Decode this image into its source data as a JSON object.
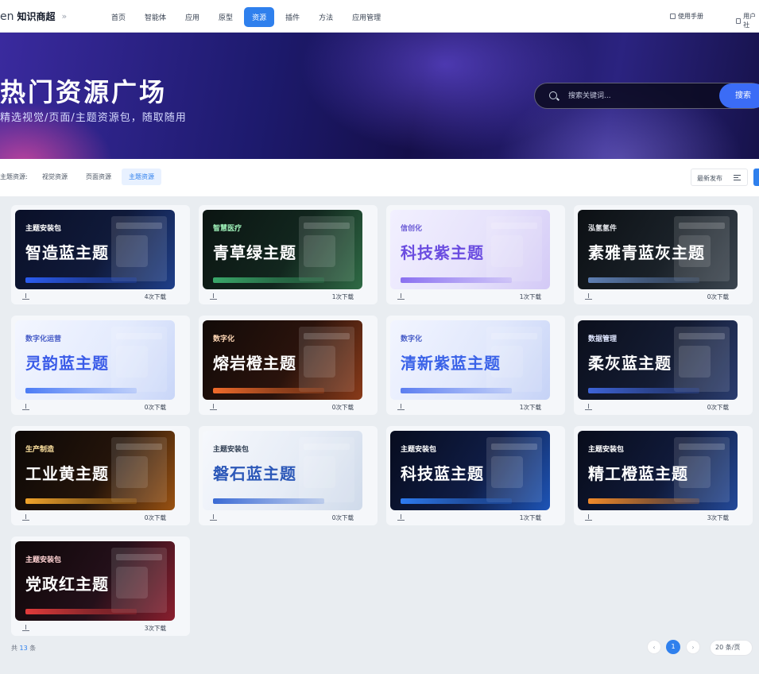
{
  "nav": {
    "logo_mark": "en",
    "brand": "知识商超",
    "chevron": "»",
    "items": [
      "首页",
      "智能体",
      "应用",
      "原型",
      "资源",
      "插件",
      "方法",
      "应用管理"
    ],
    "active": "资源",
    "manual": "使用手册",
    "user": "用户社"
  },
  "hero": {
    "title": "热门资源广场",
    "subtitle": "精选视觉/页面/主题资源包，随取随用",
    "search_placeholder": "搜索关键词...",
    "search_button": "搜索"
  },
  "filter": {
    "label": "主题资源:",
    "tags": [
      "视觉资源",
      "页面资源",
      "主题资源"
    ],
    "active": "主题资源",
    "sort": "最新发布"
  },
  "cards": [
    {
      "tag": "主题安装包",
      "name": "智造蓝主题",
      "downloads": "4次下载",
      "style": "dark-blue"
    },
    {
      "tag": "智慧医疗",
      "name": "青草绿主题",
      "downloads": "1次下载",
      "style": "dark-green"
    },
    {
      "tag": "信创化",
      "name": "科技紫主题",
      "downloads": "1次下载",
      "style": "light-purple"
    },
    {
      "tag": "泓氢氢件",
      "name": "素雅青蓝灰主题",
      "downloads": "0次下载",
      "style": "dark-gray"
    },
    {
      "tag": "数字化运营",
      "name": "灵韵蓝主题",
      "downloads": "0次下载",
      "style": "light-blue"
    },
    {
      "tag": "数字化",
      "name": "熔岩橙主题",
      "downloads": "0次下载",
      "style": "dark-orange"
    },
    {
      "tag": "数字化",
      "name": "清新紫蓝主题",
      "downloads": "1次下载",
      "style": "light-periwinkle"
    },
    {
      "tag": "数据管理",
      "name": "柔灰蓝主题",
      "downloads": "0次下载",
      "style": "dark-navy"
    },
    {
      "tag": "生产制造",
      "name": "工业黄主题",
      "downloads": "0次下载",
      "style": "dark-amber"
    },
    {
      "tag": "主题安装包",
      "name": "磐石蓝主题",
      "downloads": "0次下载",
      "style": "light-slate"
    },
    {
      "tag": "主题安装包",
      "name": "科技蓝主题",
      "downloads": "1次下载",
      "style": "dark-tech"
    },
    {
      "tag": "主题安装包",
      "name": "精工橙蓝主题",
      "downloads": "3次下载",
      "style": "dark-navy2"
    },
    {
      "tag": "主题安装包",
      "name": "党政红主题",
      "downloads": "3次下载",
      "style": "dark-red"
    }
  ],
  "pagination": {
    "total_prefix": "共",
    "total": "13",
    "total_suffix": "条",
    "prev": "‹",
    "current": "1",
    "next": "›",
    "page_size": "20 条/页"
  },
  "colors": {
    "accent": "#2f80ed",
    "page_bg": "#e9edf1"
  }
}
